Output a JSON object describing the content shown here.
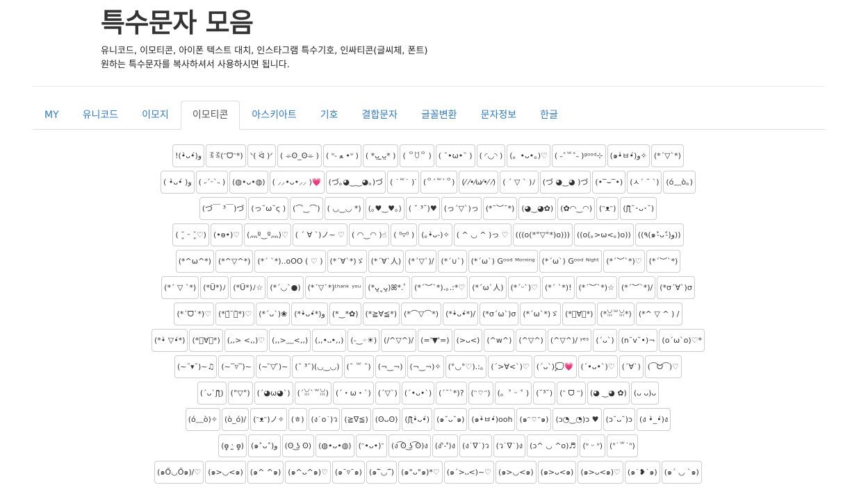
{
  "header": {
    "title": "특수문자 모음",
    "desc_line1": "유니코드, 이모티콘, 아이폰 텍스트 대치, 인스타그램 특수기호, 인싸티콘(글씨체, 폰트)",
    "desc_line2": "원하는 특수문자를 복사하셔서 사용하시면 됩니다."
  },
  "tabs": [
    {
      "label": "MY",
      "active": false
    },
    {
      "label": "유니코드",
      "active": false
    },
    {
      "label": "이모지",
      "active": false
    },
    {
      "label": "이모티콘",
      "active": true
    },
    {
      "label": "아스키아트",
      "active": false
    },
    {
      "label": "기호",
      "active": false
    },
    {
      "label": "결합문자",
      "active": false
    },
    {
      "label": "글꼴변환",
      "active": false
    },
    {
      "label": "문자정보",
      "active": false
    },
    {
      "label": "한글",
      "active": false
    }
  ],
  "emoticon_rows": [
    [
      "!(•̀ᴗ•́)و",
      "ꉂꉂ(ᵔᗜᵔ*)",
      "ᐠ( ᐛ )ᐟ",
      "( ⌯ʘ_ʘ⌯ )",
      "( ᐡ- ﻌ •ᐡ )",
      "( *ᴗ̤ ̫ᴗ̤* )",
      "( ꒪ꇴ꒪ )",
      "( ˘•ω•˘ )",
      "( ◜◡◝ )",
      "(。•ᴗ•。)♡",
      "( ˶ˆ꒳ˆ˵ )ᵍᵒᵒᵈ⊹",
      "(๑•̀ㅂ•́)و✧",
      "(*´▽`*)"
    ],
    [
      "( •̀ᴗ•́ )و",
      "( ˶ˊᵕˋ˵ )",
      "(◍•ᴗ•◍)",
      "( ⸝⸝•ᴗ•⸝⸝ )💗",
      "(づ｡◕‿‿◕｡)づ",
      "( ˙꒳˙ )ᐝ",
      "(꒪ˊ꒳ˋ꒪)",
      "(⁄ ⁄•⁄ω⁄•⁄ ⁄)",
      "( ´ ▽ ` )ﾉ",
      "(づ ◕‿◕ )づ",
      "(•‾⌣‾•)",
      "(ㅅ´ ˘ `)",
      "(ó﹏ò｡)"
    ],
    [
      "(づ￣ ³￣)づ",
      "(っ˘ω˘ς )",
      "(⌒‿⌒)",
      "( ◡‿◡ *)",
      "(｡♥‿♥｡)",
      "( ˘ ³˘)♥",
      "(っ´▽`)っ",
      "(*¯︶¯*)",
      "(◕‿◕✿)",
      "(✿◠‿◠)",
      "(ᵔᴥᵔ)",
      "(ʃƪ˘･ᴗ･˘)"
    ],
    [
      "( ˘͈ ᵕ ˘͈♡)",
      "(•ө•)♡",
      "(灬º‿º灬)♡",
      "( ´ ∀ `)ノ~ ♡",
      "( ◠‿◠ )☝",
      "( ⁰▿⁰ )",
      "(｡•̀ᴗ-)✧",
      "( ^ ◡ ^ )っ ♡",
      "(((o(*°▽°*)o)))",
      "((o(｡>ω<｡)o))",
      "((٩(๑˃̵ᴗ˂̵)و))"
    ],
    [
      "(*^ω^*)",
      "(*^▽^*)",
      "(*´ `*)..oOO ( ♡ )",
      "(*´∀`*)ゞ",
      "(*´∀`人)",
      "(*´▽`)/",
      "(*´∪`)",
      "(*´ω`) Gᵒᵒᵈ ᴹᵒʳⁿⁱⁿᵍ",
      "(*´ω`) Gᵒᵒᵈ ᴺⁱᵍʰᵗ",
      "(*´︶`*)♡",
      "(*´︶`*)"
    ],
    [
      "(*´ ▽ `*)",
      "(*Ü*)ﾉ",
      "(*Ü*)ﾉ☆",
      "(*´◡`●)",
      "(*´▽`*)ᵗʰᵃⁿᵏ ʸᵒᵘ",
      "(*ᴗ͈ˬᴗ͈)ꕤ*.ﾟ",
      "(*´︶`*).｡.:*♡",
      "(*´ω`人)",
      "(*ˊᵕˋ)♡",
      "(*´ `*)!",
      "(*´︶`*)☆",
      "(*´︶`*)/",
      "(*σ´∀`)σ"
    ],
    [
      "(*´ᗜ`*)♡",
      "(*ฅ́˘ฅ̀*)♡",
      "(*´ᴗ`)❀",
      "(*•̀ᴗ•́*)و",
      "(*‿*✿)",
      "(*≧∀≦*)",
      "(*⌒▽⌒*)",
      "(*•̀ᴗ•́*)/",
      "(*σ´ω`)σ",
      "(*´ω`*)ゞ",
      "(*ﾟ∀ﾟ*)",
      "(*ꈍ꒳ꈍ*)",
      "(*^ ▽ ^ ) /"
    ],
    [
      "(*•̀ ▽•́*)",
      "(*ﾟ∀ﾟ*)",
      "(,,> <,,)♡",
      "(,,>﹏<,,)",
      "(,,•᎑•,,)",
      "(-‿◦☀)",
      "(/^▽^)/",
      "(='▼'=)",
      "(>ᴗ<)",
      "(^w^)",
      "(^▽^)",
      "(^▽^)/ ʸᵉˢ",
      "(´ᴗ`)",
      "(n˘v˘•)¬",
      "(o´ω`o)♡*"
    ],
    [
      "(~˘▾˘)~♫",
      "(~‾▿‾)~",
      "(~ ̄▽ ̄)~",
      "(¯ ³¯)(◡‿◡)",
      "(¯ ꒳ ¯)",
      "(¬‿¬)",
      "(¬‿¬)✧",
      "(°◡°♡).:｡",
      "(´>∀<`)♡",
      "(´ᴗ`)💭💗",
      "(´•ᴗ•`)♡",
      "(´∀`)",
      "(⁀ᗢ⁀)♡"
    ],
    [
      "(´ᴗ`ʃƪ)",
      "(°▽°)",
      "(´◕ω◕`)",
      "(´ꈍ`꒳ꈍ)",
      "(´・ω・`)",
      "(´▽`)",
      "(´•ᴗ•`)",
      "(´˘`*)?",
      "(ᵔ⌔ᵔ)",
      "(。˃ ᵕ ˂ )",
      "(˘³˘)",
      "(ᵔ ᗜ ᵔ)",
      "(◕ ‿◕ ✿)",
      "(ᴗ ᴗ)ᴗ"
    ],
    [
      "(ó﹏ò)✧",
      "(ò_ó)/",
      "(ᵔᴥᵔ)ノ✧",
      "(ㅎ)",
      "(ง˙o˙)ว",
      "(≧∇≦)",
      "(ʘᴗʘ)",
      "(ʃƪ•̀ᴗ•́)",
      "(๑˘ᴗ˘๑)",
      "(๑•̀ㅂ•́)ooh",
      "(๑ᵔ⌔ᵔ๑)",
      "(ɔ◔‿◔)ɔ ♥",
      "(ɔ˘ᴗ˘)ɔ",
      "(ง •̀_•́)ง"
    ],
    [
      "(ɵ̥̥ ˑ̫ ɵ̥̥)",
      "(๑˃ᴗ˂)ﻭ",
      "(ʘ ͜ʖ ʘ)",
      "(◍•ᴗ•◍)",
      "(ᵔ•ᴗ•)ᵔ",
      "(ง ͡ʘ ͜ʖ ͡ʘ)ง",
      "(ง'̀-'́)ง",
      "(ง˙∇˙)ว",
      "(ว˙∇˙)ง",
      "(ɔ^ ◡ ^o)♬",
      "(ᐡ ᵕ ᐡ)",
      "(ᐢ˙꒳˙ᐢ)"
    ],
    [
      "(๑Ő◡Ő๑)/♡",
      "(๑>◡<๑)",
      "(๑^ ^๑)",
      "(๑^ᴗ^๑)♡",
      "(๑¯▿¯๑)",
      "(๑‾̀◡‾́)",
      "(๑°ᴗ°๑)*♡",
      "(๑´>᎑<)~♡",
      "(๑>◡<๑)",
      "(๑>ᴗ<๑)",
      "(๑>ᴗ<๑)♡",
      "(๑˙❥˙๑)",
      "(๑´ ◡ `๑)"
    ]
  ]
}
